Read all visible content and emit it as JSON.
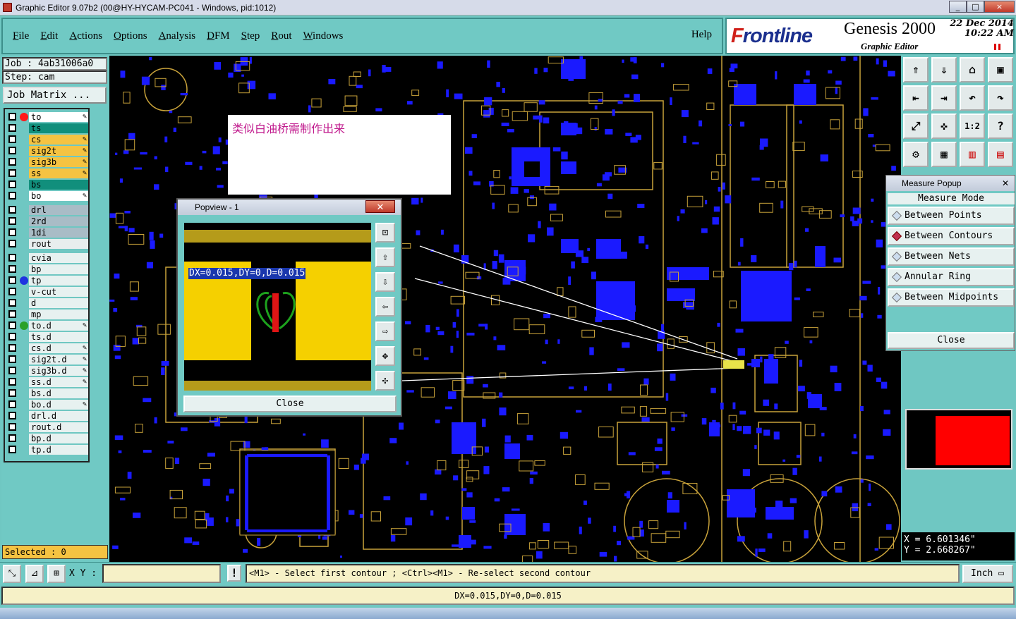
{
  "window": {
    "title": "Graphic Editor 9.07b2 (00@HY-HYCAM-PC041 - Windows, pid:1012)",
    "controls": [
      "_",
      "□",
      "×"
    ]
  },
  "menu": [
    "File",
    "Edit",
    "Actions",
    "Options",
    "Analysis",
    "DFM",
    "Step",
    "Rout",
    "Windows"
  ],
  "help": "Help",
  "brand": {
    "logo_pre": "F",
    "logo": "rontline",
    "product": "Genesis 2000",
    "module": "Graphic Editor",
    "date": "22 Dec 2014",
    "time": "10:22 AM"
  },
  "job": {
    "job": "Job : 4ab31006a0",
    "step": "Step: cam",
    "matrix": "Job Matrix ..."
  },
  "layers": [
    {
      "name": "to",
      "bg": "#ffffff",
      "dot": "#ff1a1a",
      "edit": true
    },
    {
      "name": "ts",
      "bg": "#118f7c",
      "dot": "",
      "edit": false
    },
    {
      "name": "cs",
      "bg": "#f5c342",
      "dot": "",
      "edit": true
    },
    {
      "name": "sig2t",
      "bg": "#f5c342",
      "dot": "",
      "edit": true
    },
    {
      "name": "sig3b",
      "bg": "#f5c342",
      "dot": "",
      "edit": true
    },
    {
      "name": "ss",
      "bg": "#f5c342",
      "dot": "",
      "edit": true
    },
    {
      "name": "bs",
      "bg": "#118f7c",
      "dot": "",
      "edit": false
    },
    {
      "name": "bo",
      "bg": "#ffffff",
      "dot": "",
      "edit": true
    },
    {
      "name": "drl",
      "bg": "#a9bcc6",
      "dot": "",
      "edit": false
    },
    {
      "name": "2rd",
      "bg": "#a9bcc6",
      "dot": "",
      "edit": false
    },
    {
      "name": "1di",
      "bg": "#a9bcc6",
      "dot": "",
      "edit": false
    },
    {
      "name": "rout",
      "bg": "#e8eeee",
      "dot": "",
      "edit": false
    },
    {
      "name": "cvia",
      "bg": "#e7f1f0",
      "dot": "",
      "edit": false
    },
    {
      "name": "bp",
      "bg": "#e7f1f0",
      "dot": "",
      "edit": false
    },
    {
      "name": "tp",
      "bg": "#e7f1f0",
      "dot": "#1f33e0",
      "edit": false
    },
    {
      "name": "v-cut",
      "bg": "#e7f1f0",
      "dot": "",
      "edit": false
    },
    {
      "name": "d",
      "bg": "#e7f1f0",
      "dot": "",
      "edit": false
    },
    {
      "name": "mp",
      "bg": "#e7f1f0",
      "dot": "",
      "edit": false
    },
    {
      "name": "to.d",
      "bg": "#e7f1f0",
      "dot": "#2aa12a",
      "edit": true
    },
    {
      "name": "ts.d",
      "bg": "#e7f1f0",
      "dot": "",
      "edit": false
    },
    {
      "name": "cs.d",
      "bg": "#e7f1f0",
      "dot": "",
      "edit": true
    },
    {
      "name": "sig2t.d",
      "bg": "#e7f1f0",
      "dot": "",
      "edit": true
    },
    {
      "name": "sig3b.d",
      "bg": "#e7f1f0",
      "dot": "",
      "edit": true
    },
    {
      "name": "ss.d",
      "bg": "#e7f1f0",
      "dot": "",
      "edit": true
    },
    {
      "name": "bs.d",
      "bg": "#e7f1f0",
      "dot": "",
      "edit": false
    },
    {
      "name": "bo.d",
      "bg": "#e7f1f0",
      "dot": "",
      "edit": true
    },
    {
      "name": "drl.d",
      "bg": "#e7f1f0",
      "dot": "",
      "edit": false
    },
    {
      "name": "rout.d",
      "bg": "#e7f1f0",
      "dot": "",
      "edit": false
    },
    {
      "name": "bp.d",
      "bg": "#e7f1f0",
      "dot": "",
      "edit": false
    },
    {
      "name": "tp.d",
      "bg": "#e7f1f0",
      "dot": "",
      "edit": false
    }
  ],
  "selected": "Selected : 0",
  "annotation": "类似白油桥需制作出来",
  "popview": {
    "title": "Popview - 1",
    "measure": "DX=0.015,DY=0,D=0.015",
    "close": "Close"
  },
  "measure_popup": {
    "title": "Measure Popup",
    "heading": "Measure Mode",
    "modes": [
      "Between Points",
      "Between Contours",
      "Between Nets",
      "Annular Ring",
      "Between Midpoints"
    ],
    "selected_mode": "Between Contours",
    "close": "Close"
  },
  "coords": {
    "x": "X =  6.601346\"",
    "y": "Y =  2.668267\""
  },
  "bottom": {
    "xy_label": "X Y :",
    "xy_value": "",
    "prompt": "<M1> - Select first contour ; <Ctrl><M1> - Re-select second contour",
    "units": "Inch"
  },
  "status": "DX=0.015,DY=0,D=0.015",
  "colors": {
    "accent": "#70c9c4",
    "pad": "#1a1aff",
    "outline": "#c8a23a",
    "copper": "#f5d000"
  }
}
